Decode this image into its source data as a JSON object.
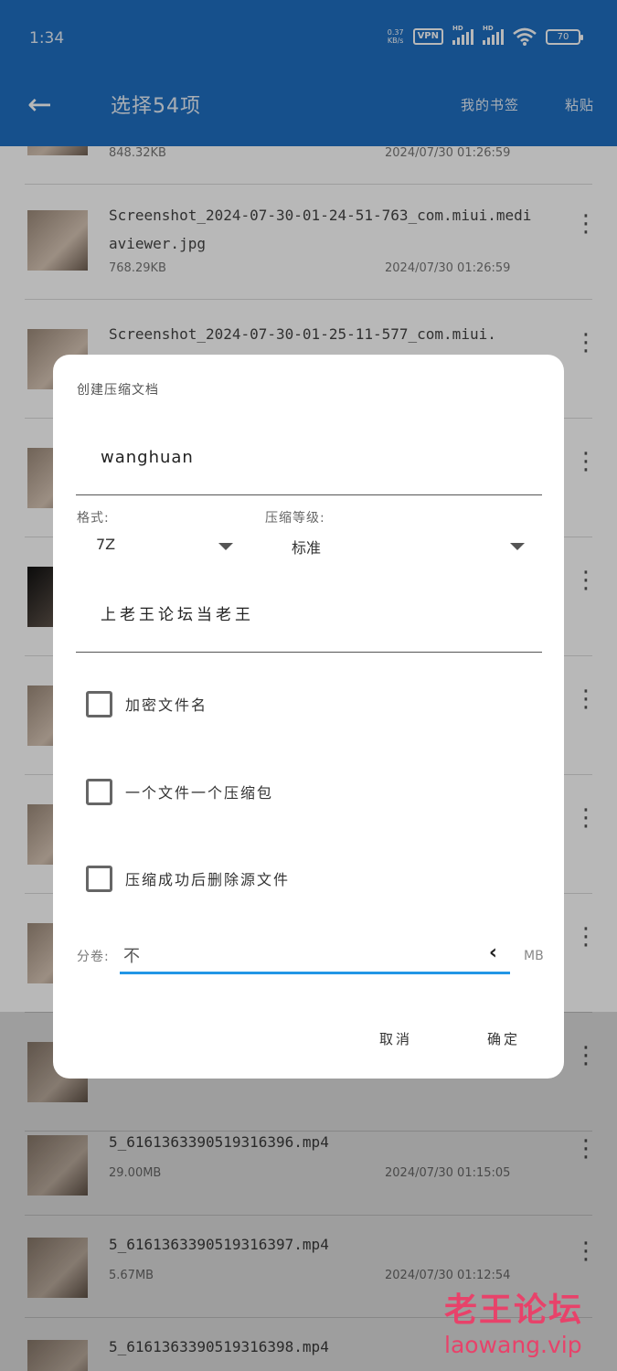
{
  "status_bar": {
    "time": "1:34",
    "net_speed_value": "0.37",
    "net_speed_unit": "KB/s",
    "vpn": "VPN",
    "hd1": "HD",
    "hd2": "HD",
    "battery": "70"
  },
  "app_bar": {
    "title": "选择54项",
    "bookmarks": "我的书签",
    "paste": "粘贴"
  },
  "files": [
    {
      "name": "",
      "size": "848.32KB",
      "date": "2024/07/30 01:26:59"
    },
    {
      "name": "Screenshot_2024-07-30-01-24-51-763_com.miui.mediaviewer.jpg",
      "size": "768.29KB",
      "date": "2024/07/30 01:26:59"
    },
    {
      "name": "Screenshot_2024-07-30-01-25-11-577_com.miui.",
      "size": "",
      "date": ""
    },
    {
      "name": "5_6161363390519316396.mp4",
      "size": "29.00MB",
      "date": "2024/07/30 01:15:05"
    },
    {
      "name": "5_6161363390519316397.mp4",
      "size": "5.67MB",
      "date": "2024/07/30 01:12:54"
    },
    {
      "name": "5_6161363390519316398.mp4",
      "size": "",
      "date": ""
    }
  ],
  "dialog": {
    "title": "创建压缩文档",
    "archive_name": "wanghuan",
    "format_label": "格式:",
    "format_value": "7Z",
    "level_label": "压缩等级:",
    "level_value": "标准",
    "password": "上老王论坛当老王",
    "options": [
      {
        "label": "加密文件名",
        "checked": false
      },
      {
        "label": "一个文件一个压缩包",
        "checked": false
      },
      {
        "label": "压缩成功后删除源文件",
        "checked": false
      }
    ],
    "split_label": "分卷:",
    "split_value": "不",
    "split_unit": "MB",
    "cancel": "取消",
    "ok": "确定"
  },
  "watermark": {
    "name": "老王论坛",
    "url": "laowang.vip"
  }
}
